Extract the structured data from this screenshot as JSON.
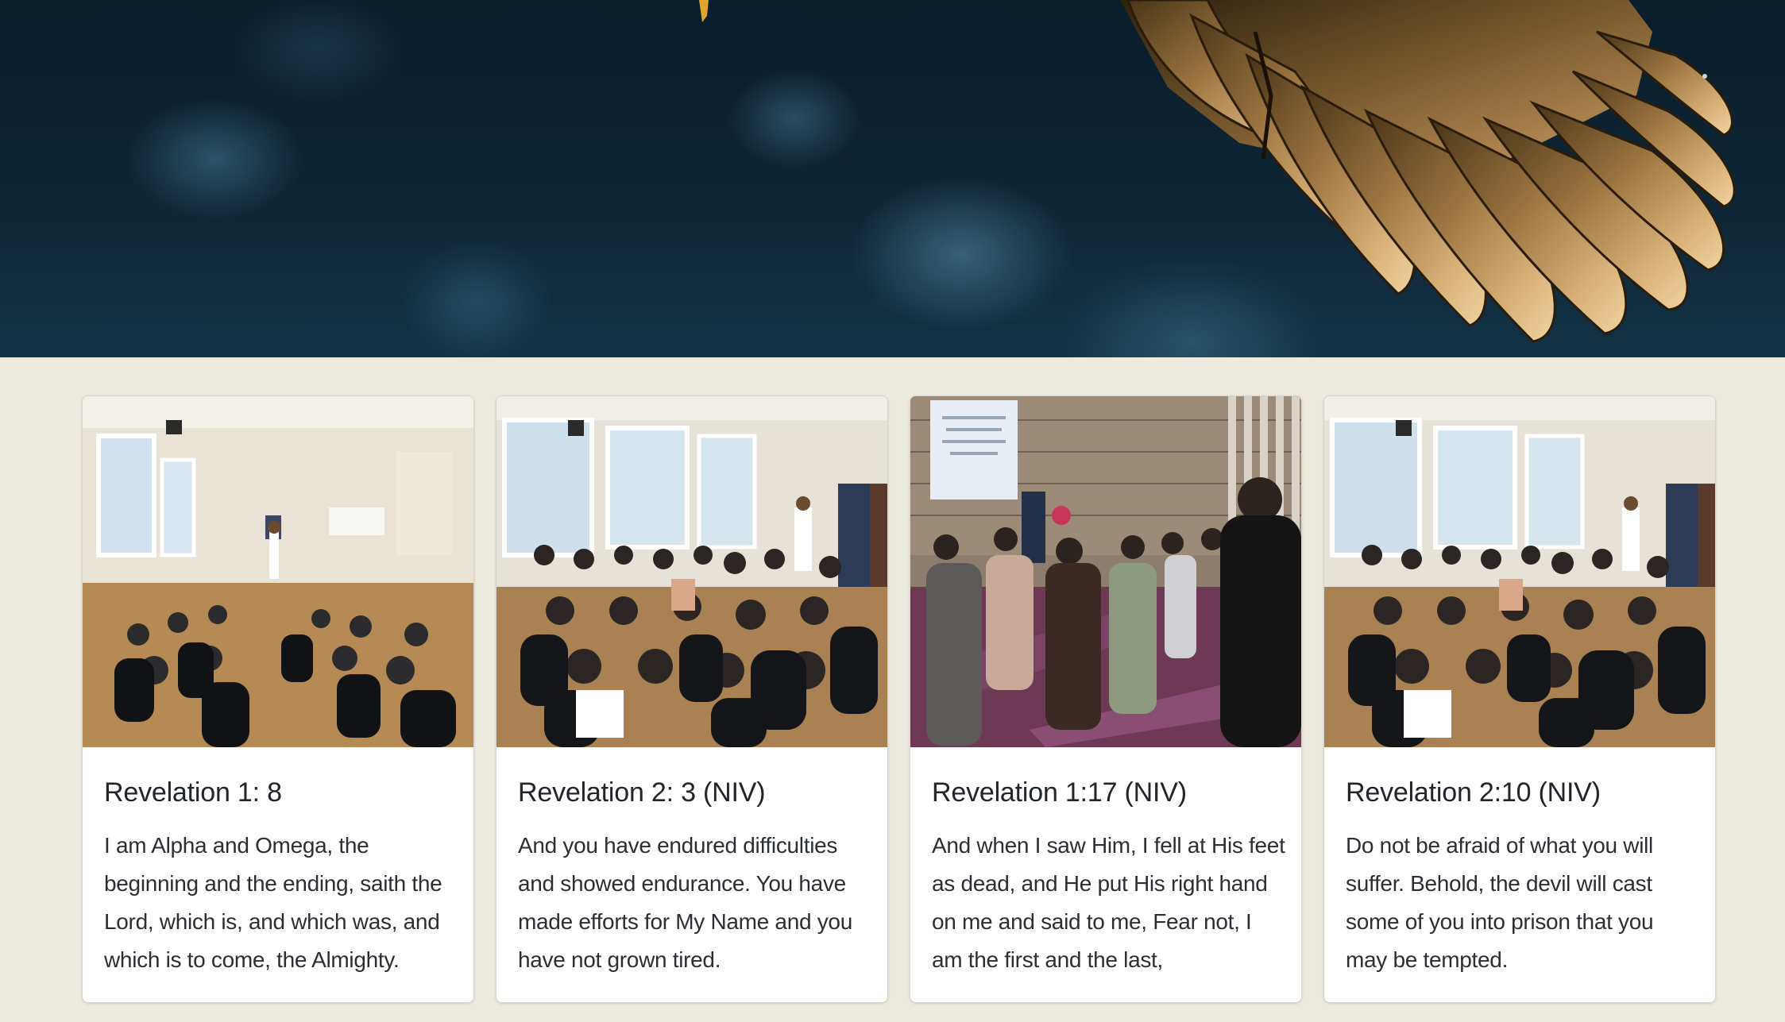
{
  "hero": {
    "image_icon": "eagle-wing-icon"
  },
  "cards": [
    {
      "title": "Revelation 1: 8",
      "text": "I am Alpha and Omega, the beginning and the ending, saith the Lord, which is, and which was, and which is to come, the Almighty.",
      "image_icon": "church-gathering-photo"
    },
    {
      "title": "Revelation 2: 3 (NIV)",
      "text": "And you have endured difficulties and showed endurance. You have made efforts for My Name and you have not grown tired.",
      "image_icon": "church-gathering-photo"
    },
    {
      "title": "Revelation 1:17 (NIV)",
      "text": "And when I saw Him, I fell at His feet as dead, and He put His right hand on me and said to me, Fear not, I am the first and the last,",
      "image_icon": "church-worship-photo"
    },
    {
      "title": "Revelation 2:10 (NIV)",
      "text": "Do not be afraid of what you will suffer. Behold, the devil will cast some of you into prison that you may be tempted.",
      "image_icon": "church-gathering-photo"
    }
  ],
  "colors": {
    "page_background": "#edebe0",
    "card_background": "#ffffff",
    "title_color": "#212529",
    "hero_dark": "#0d2535",
    "wing_gold": "#b88a4e"
  }
}
